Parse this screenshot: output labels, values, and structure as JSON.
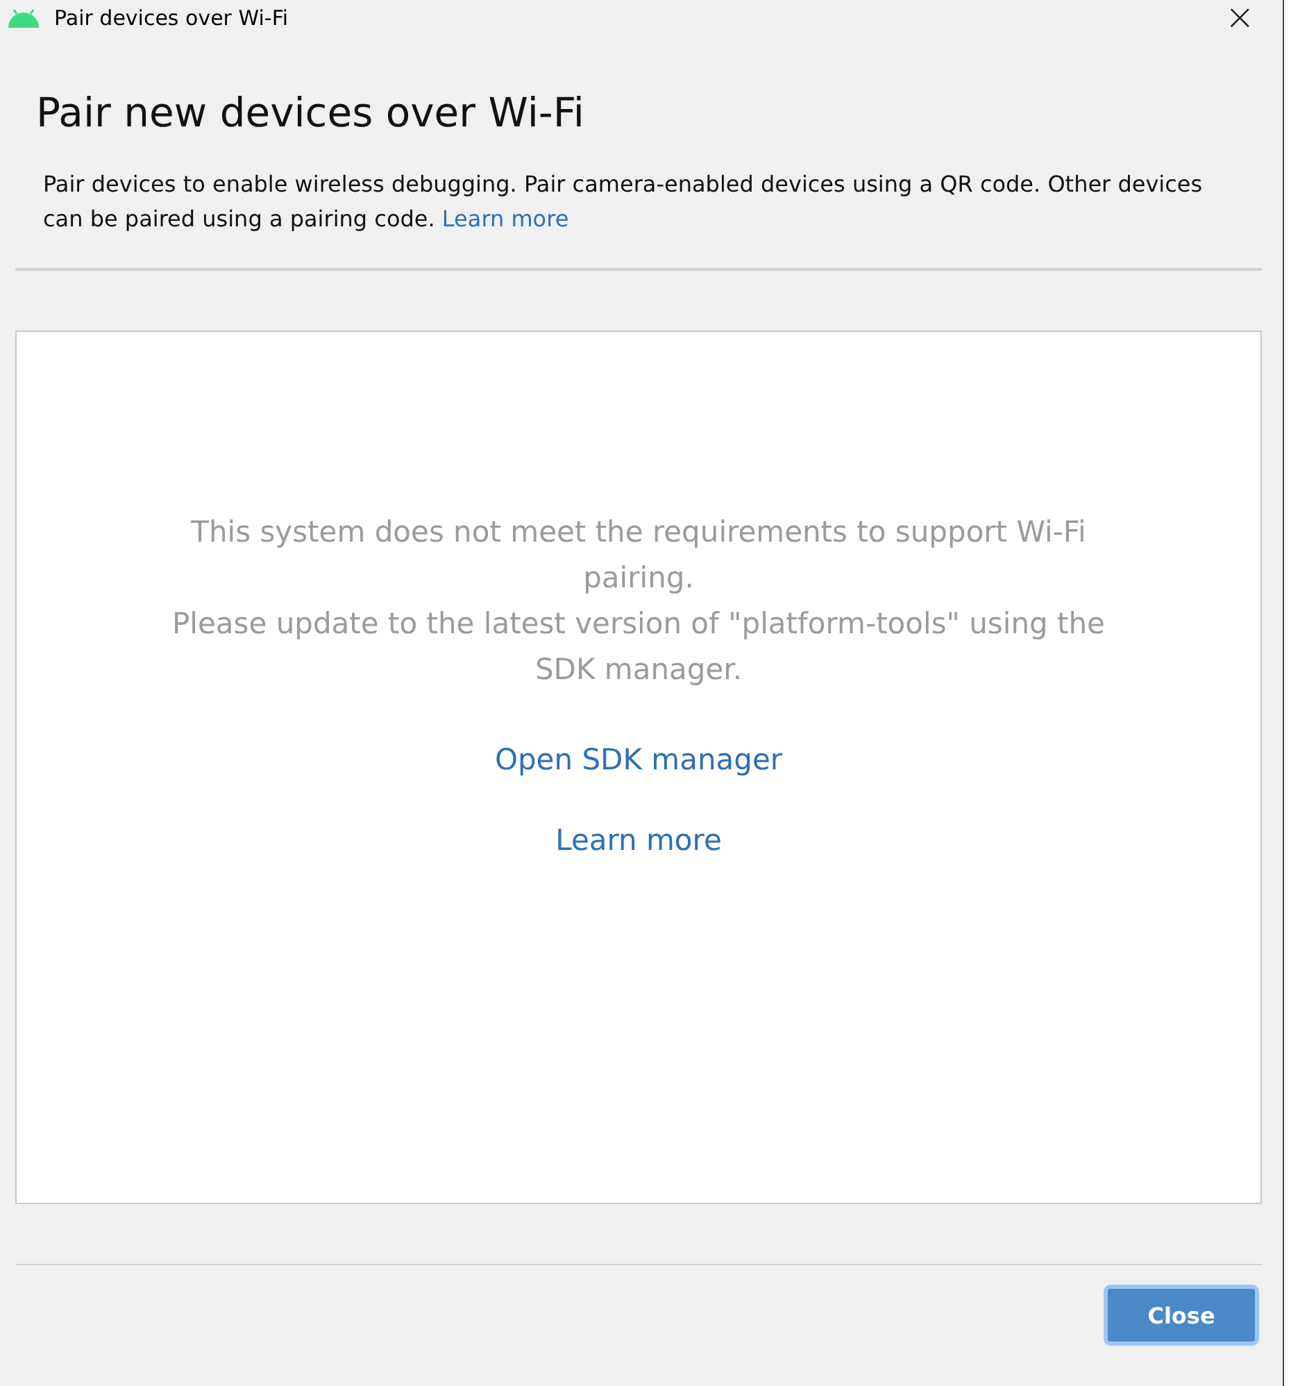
{
  "window": {
    "title": "Pair devices over Wi-Fi",
    "close": "×"
  },
  "heading": "Pair new devices over Wi-Fi",
  "description": {
    "text": "Pair devices to enable wireless debugging. Pair camera-enabled devices using a QR code. Other devices can be paired using a pairing code.",
    "link": "Learn more"
  },
  "panel": {
    "message": [
      "This system does not meet the requirements to support Wi-Fi pairing.",
      "Please update to the latest version of \"platform-tools\" using the SDK manager."
    ],
    "links": [
      "Open SDK manager",
      "Learn more"
    ]
  },
  "buttons": [
    {
      "label": "Close",
      "selected": true
    }
  ]
}
